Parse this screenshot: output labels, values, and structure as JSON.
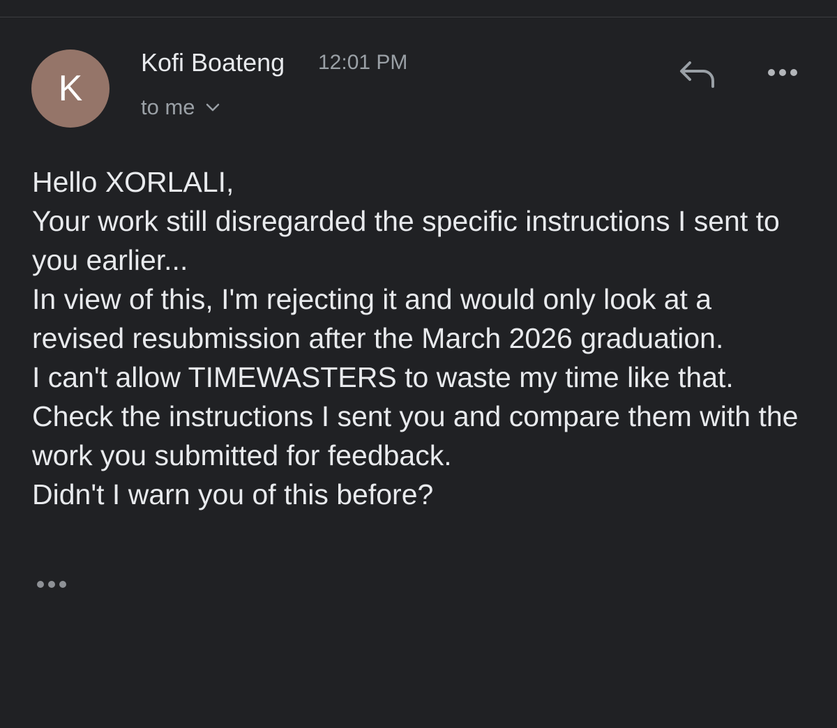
{
  "email": {
    "sender": {
      "avatar_initial": "K",
      "avatar_color": "#957569",
      "name": "Kofi Boateng",
      "time": "12:01 PM"
    },
    "recipient_label": "to me",
    "body_lines": [
      "Hello XORLALI,",
      "Your work still disregarded the specific instructions I sent to you earlier...",
      "In view of this, I'm rejecting it and would only look at a revised resubmission after the March 2026 graduation.",
      "I can't allow TIMEWASTERS to waste my time like that. Check the instructions I sent you and compare them with the work you submitted for feedback.",
      "Didn't I warn you of this before?"
    ]
  },
  "actions": {
    "reply_icon": "reply-icon",
    "more_icon": "more-horizontal-icon",
    "expand_icon": "ellipsis-icon"
  },
  "theme": {
    "background": "#202124",
    "text_primary": "#e8eaed",
    "text_secondary": "#9aa0a6"
  }
}
